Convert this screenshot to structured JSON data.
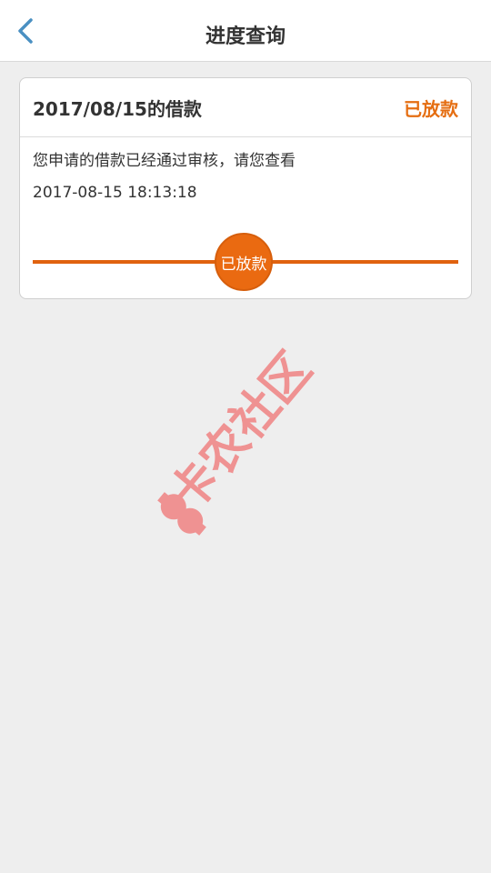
{
  "header": {
    "title": "进度查询"
  },
  "card": {
    "loan_title": "2017/08/15的借款",
    "status": "已放款",
    "message": "您申请的借款已经通过审核，请您查看",
    "timestamp": "2017-08-15 18:13:18",
    "progress_node_label": "已放款"
  },
  "watermark": {
    "text": "卡农社区"
  },
  "colors": {
    "accent": "#e56e12",
    "back_icon": "#4a90c2",
    "background": "#eeeeee",
    "watermark": "#f04848"
  }
}
